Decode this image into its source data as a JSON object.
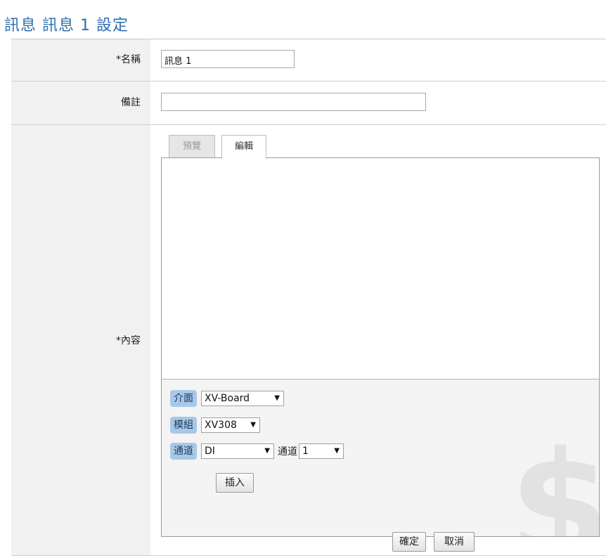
{
  "page": {
    "title": "訊息 訊息 1 設定"
  },
  "form": {
    "name": {
      "label": "*名稱",
      "value": "訊息 1"
    },
    "note": {
      "label": "備註",
      "value": ""
    },
    "content": {
      "label": "*內容",
      "tabs": [
        {
          "label": "預覽",
          "active": false
        },
        {
          "label": "編輯",
          "active": true
        }
      ],
      "body_text": "",
      "toolbar": {
        "interface_label": "介面",
        "interface_value": "XV-Board",
        "module_label": "模組",
        "module_value": "XV308",
        "channel_label": "通道",
        "channel_type_value": "DI",
        "channel_inline_label": "通道",
        "channel_number_value": "1",
        "insert_label": "插入"
      },
      "watermark": "$"
    }
  },
  "footer": {
    "ok_label": "確定",
    "cancel_label": "取消"
  },
  "colors": {
    "title": "#2f6fb1",
    "chip": "#a9c8e6",
    "label_bg": "#f1f1f1"
  }
}
